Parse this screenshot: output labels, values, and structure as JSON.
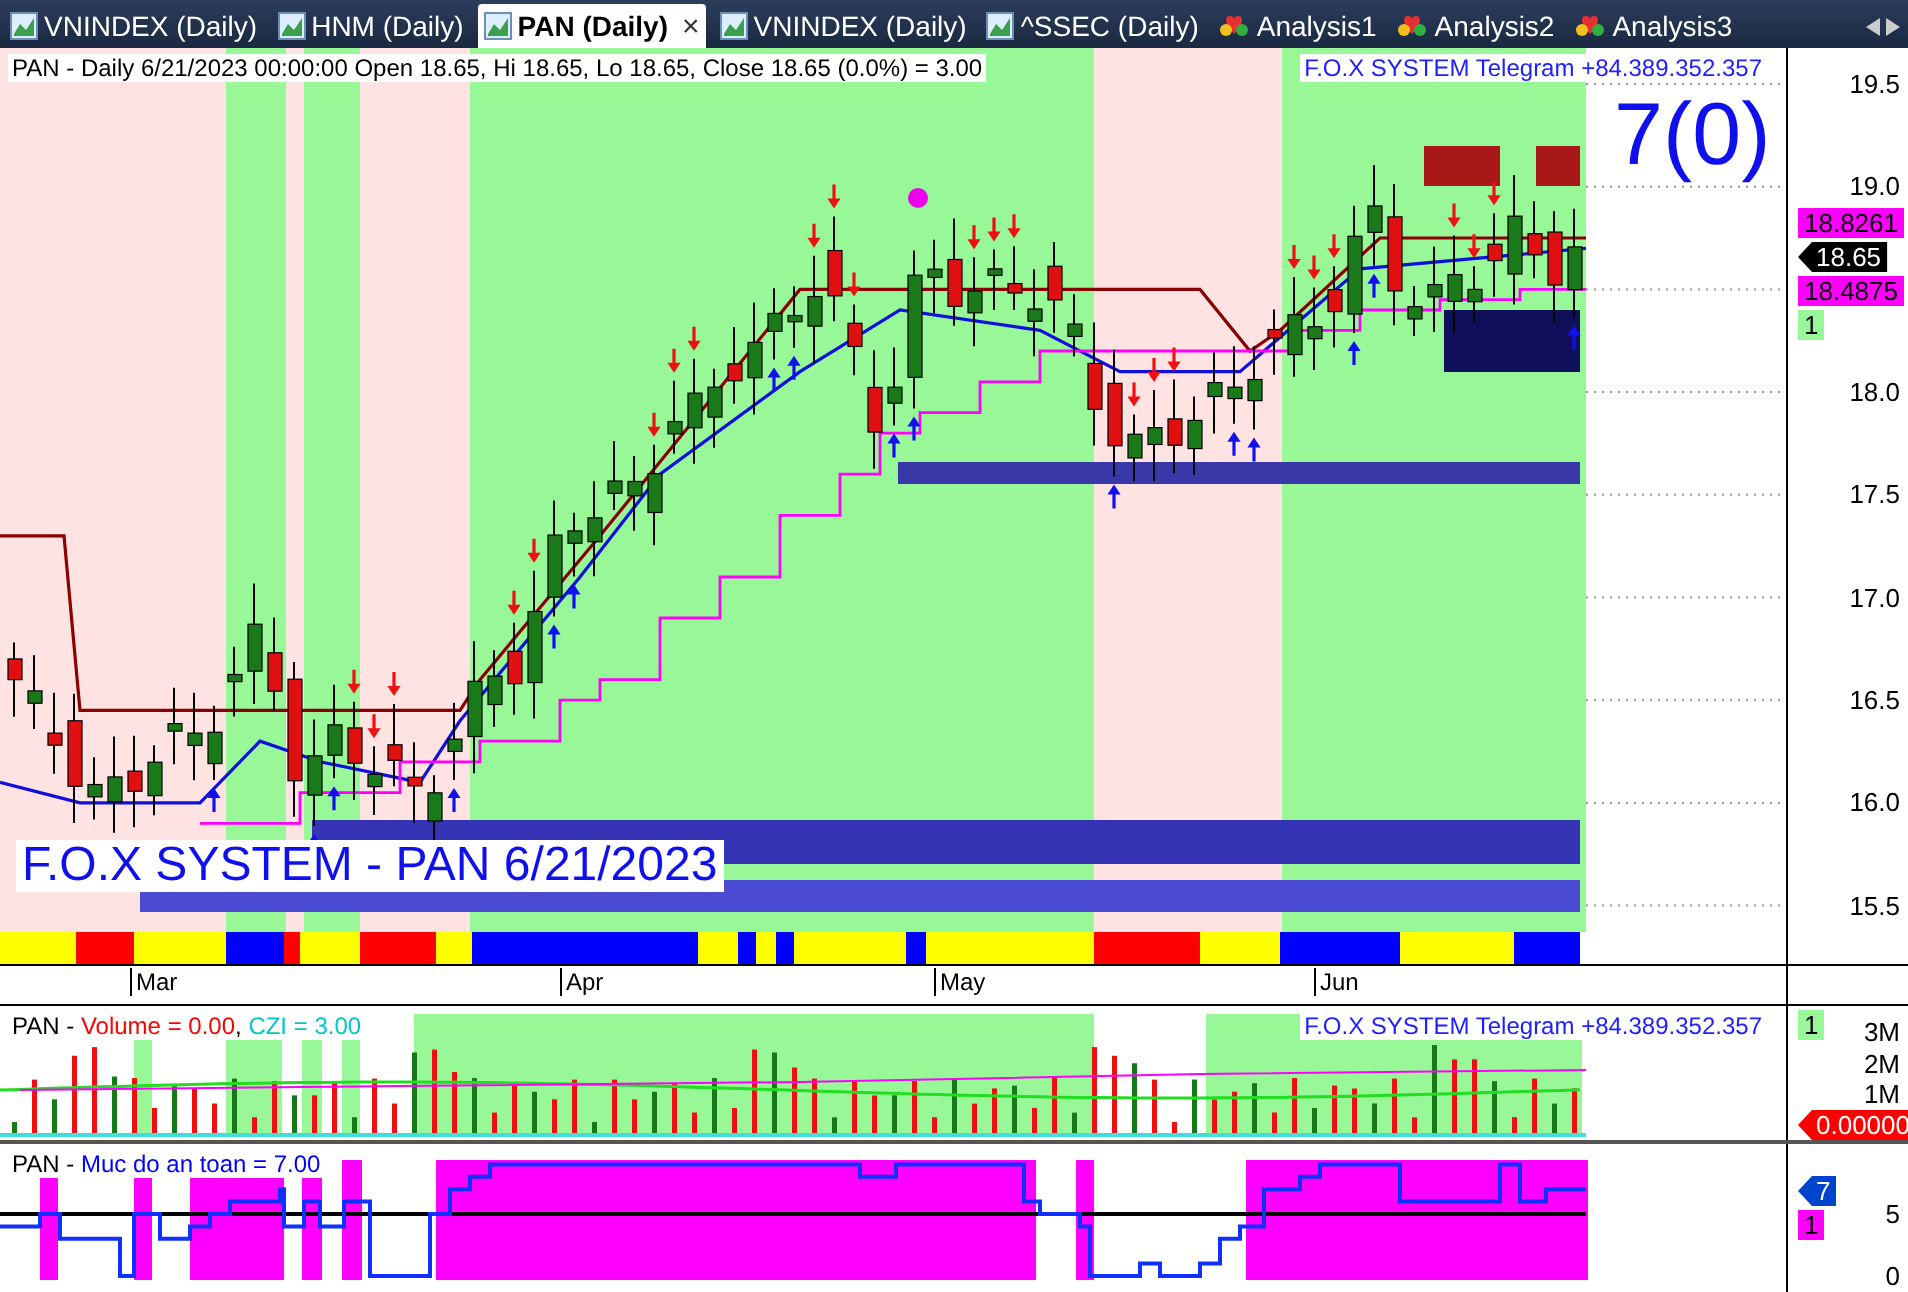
{
  "tabs": [
    {
      "label": "VNINDEX (Daily)",
      "kind": "chart",
      "selected": false
    },
    {
      "label": "HNM (Daily)",
      "kind": "chart",
      "selected": false
    },
    {
      "label": "PAN (Daily)",
      "kind": "chart",
      "selected": true,
      "close_glyph": "×"
    },
    {
      "label": "VNINDEX (Daily)",
      "kind": "chart",
      "selected": false
    },
    {
      "label": "^SSEC (Daily)",
      "kind": "chart",
      "selected": false
    },
    {
      "label": "Analysis1",
      "kind": "analysis",
      "selected": false
    },
    {
      "label": "Analysis2",
      "kind": "analysis",
      "selected": false
    },
    {
      "label": "Analysis3",
      "kind": "analysis",
      "selected": false
    }
  ],
  "price_pane": {
    "header": "PAN - Daily 6/21/2023 00:00:00 Open 18.65, Hi 18.65, Lo 18.65, Close 18.65 (0.0%)  = 3.00",
    "telegram": "F.O.X SYSTEM Telegram +84.389.352.357",
    "signal_count": "7(0)",
    "watermark": "F.O.X SYSTEM - PAN 6/21/2023",
    "axis_labels": [
      "19.5",
      "19.0",
      "18.0",
      "17.5",
      "17.0",
      "16.5",
      "16.0",
      "15.5"
    ],
    "tags": [
      {
        "text": "18.8261",
        "kind": "box",
        "color": "#ff00ff"
      },
      {
        "text": "18.65",
        "kind": "pointer",
        "color": "#000000"
      },
      {
        "text": "18.4875",
        "kind": "box",
        "color": "#ff00ff"
      },
      {
        "text": "1",
        "kind": "box",
        "color": "#98f898"
      }
    ]
  },
  "date_axis": [
    "Mar",
    "Apr",
    "May",
    "Jun"
  ],
  "volume_pane": {
    "prefix": "PAN - ",
    "items": [
      {
        "text": "Volume = 0.00",
        "color": "#ff0000"
      },
      {
        "text": ", ",
        "color": "#000000"
      },
      {
        "text": "CZI = 3.00",
        "color": "#00c8c8"
      }
    ],
    "telegram": "F.O.X SYSTEM Telegram +84.389.352.357",
    "axis_labels": [
      "3M",
      "2M",
      "1M"
    ],
    "tags": [
      {
        "text": "1",
        "kind": "box",
        "color": "#98f898"
      },
      {
        "text": "0.00000",
        "kind": "pointer",
        "color": "#ff0000"
      }
    ]
  },
  "safety_pane": {
    "prefix": "PAN - ",
    "items": [
      {
        "text": "Muc do an toan = 7.00",
        "color": "#0000ff"
      }
    ],
    "axis_labels": [
      "5",
      "0"
    ],
    "tags": [
      {
        "text": "7",
        "kind": "pointer",
        "color": "#0044cc"
      },
      {
        "text": "1",
        "kind": "box",
        "color": "#ff00ff"
      }
    ]
  }
}
